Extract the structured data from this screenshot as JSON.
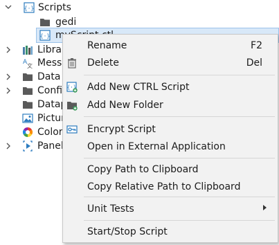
{
  "tree": {
    "items": [
      {
        "label": "Scripts",
        "icon": "script-folder-icon"
      },
      {
        "label": "gedi",
        "icon": "folder-icon"
      },
      {
        "label": "myScript.ctl",
        "icon": "script-file-icon"
      },
      {
        "label": "Libraries",
        "icon": "libraries-icon"
      },
      {
        "label": "Messages",
        "icon": "messages-icon"
      },
      {
        "label": "Data",
        "icon": "folder-icon"
      },
      {
        "label": "Config",
        "icon": "folder-icon"
      },
      {
        "label": "Datapoints",
        "icon": "folder-icon"
      },
      {
        "label": "Pictures",
        "icon": "pictures-icon"
      },
      {
        "label": "Colors",
        "icon": "colors-icon"
      },
      {
        "label": "Panels",
        "icon": "panels-icon"
      }
    ]
  },
  "context_menu": {
    "rename": {
      "label": "Rename",
      "shortcut": "F2"
    },
    "delete": {
      "label": "Delete",
      "shortcut": "Del",
      "icon": "trash-icon"
    },
    "add_ctrl_script": {
      "label": "Add New CTRL Script",
      "icon": "add-script-icon"
    },
    "add_folder": {
      "label": "Add New Folder",
      "icon": "add-folder-icon"
    },
    "encrypt": {
      "label": "Encrypt Script",
      "icon": "encrypt-icon"
    },
    "open_external": {
      "label": "Open in External Application"
    },
    "copy_path": {
      "label": "Copy Path to Clipboard"
    },
    "copy_relative_path": {
      "label": "Copy Relative Path to Clipboard"
    },
    "unit_tests": {
      "label": "Unit Tests"
    },
    "start_stop": {
      "label": "Start/Stop Script"
    }
  },
  "colors": {
    "selection": "#d8e8f8",
    "menu_background": "#f2f2f2",
    "folder": "#5a5a5a",
    "script_icon": "#2b7bbf"
  }
}
